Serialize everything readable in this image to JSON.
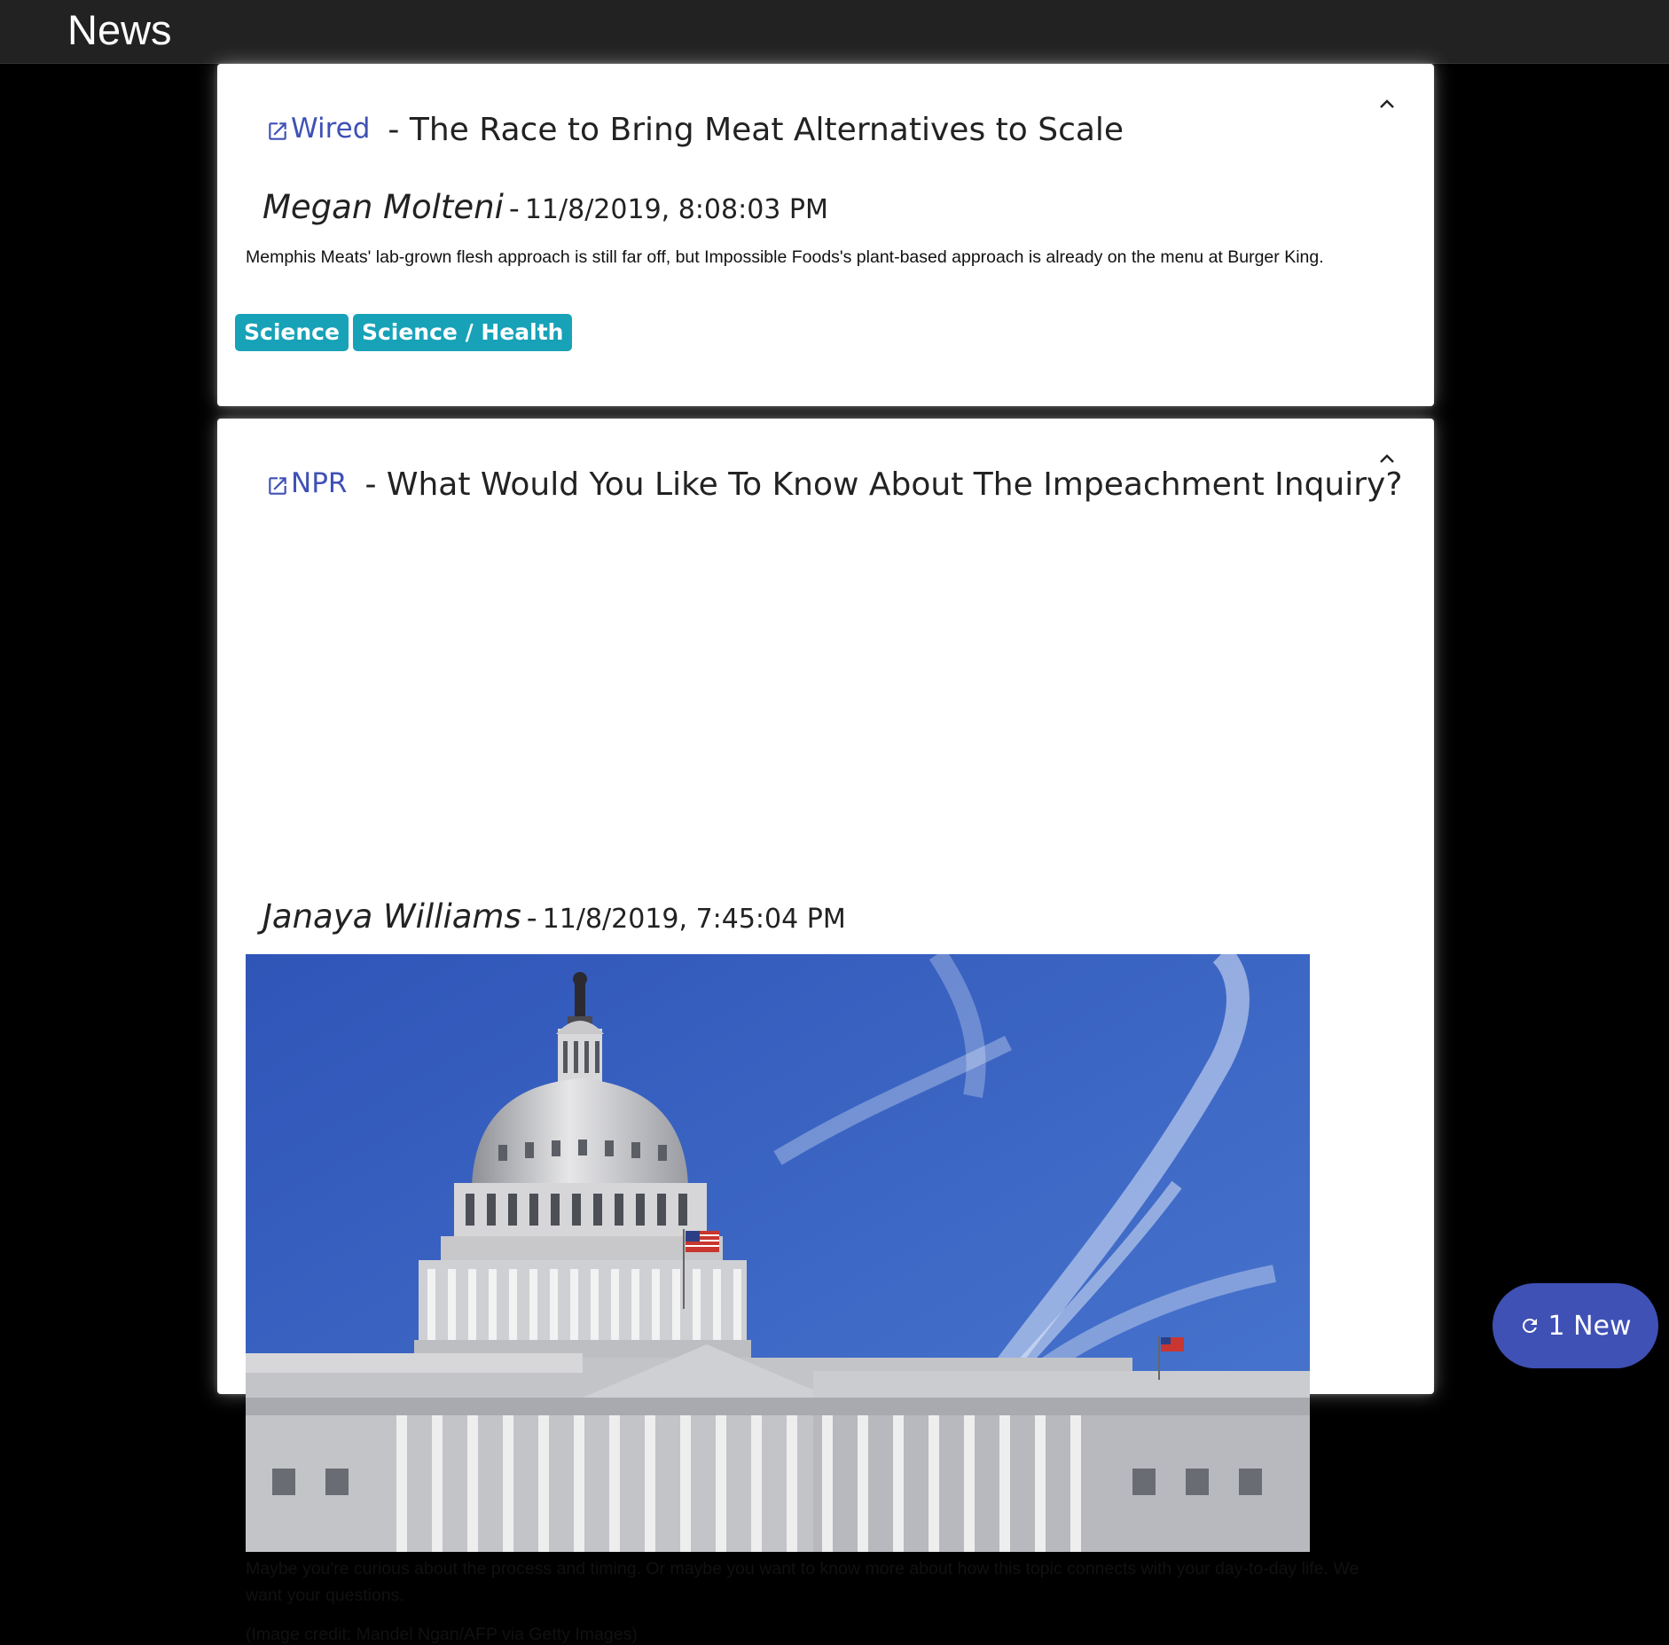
{
  "app": {
    "title": "News"
  },
  "articles": [
    {
      "source": "Wired",
      "headline": "- The Race to Bring Meat Alternatives to Scale",
      "author": "Megan Molteni",
      "separator": "-",
      "timestamp": "11/8/2019, 8:08:03 PM",
      "summary": "Memphis Meats' lab-grown flesh approach is still far off, but Impossible Foods's plant-based approach is already on the menu at Burger King.",
      "tags": [
        "Science",
        "Science / Health"
      ]
    },
    {
      "source": "NPR",
      "headline": "- What Would You Like To Know About The Impeachment Inquiry?",
      "author": "Janaya Williams",
      "separator": "-",
      "timestamp": "11/8/2019, 7:45:04 PM",
      "summary": "Maybe you're curious about the process and timing. Or maybe you want to know more about how this topic connects with your day-to-day life. We want your questions.",
      "image_credit": "(Image credit: Mandel Ngan/AFP via Getty Images)"
    }
  ],
  "new_button": {
    "label": "1 New",
    "icon": "refresh-icon"
  },
  "icons": {
    "external_link": "external-link-icon",
    "collapse": "chevron-up-icon"
  },
  "colors": {
    "accent": "#3f51b5",
    "tag": "#17a2b8",
    "header": "#222222",
    "background": "#000000"
  }
}
